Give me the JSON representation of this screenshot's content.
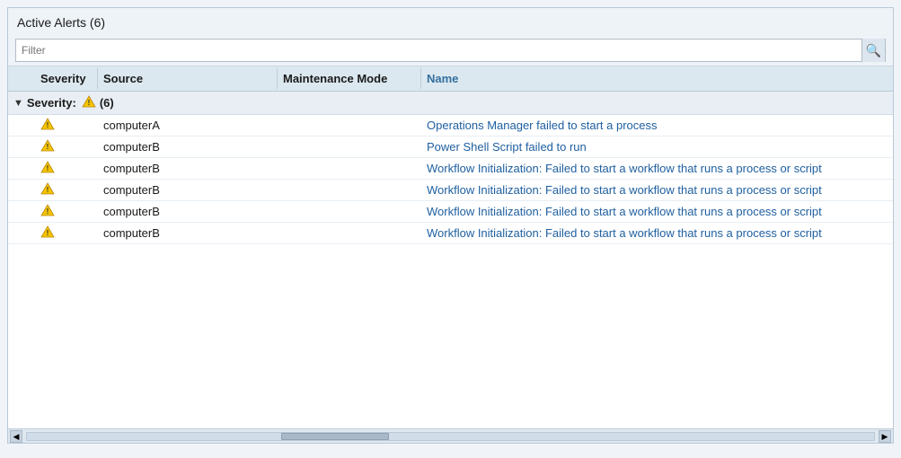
{
  "title": "Active Alerts (6)",
  "search": {
    "placeholder": "Filter",
    "value": ""
  },
  "columns": {
    "severity": "Severity",
    "source": "Source",
    "maintenance": "Maintenance Mode",
    "name": "Name"
  },
  "group": {
    "label": "Severity:",
    "count": "(6)"
  },
  "rows": [
    {
      "severity": "warning",
      "source": "computerA",
      "maintenance": "",
      "name": "Operations Manager failed to start a process"
    },
    {
      "severity": "warning",
      "source": "computerB",
      "maintenance": "",
      "name": "Power Shell Script failed to run"
    },
    {
      "severity": "warning",
      "source": "computerB",
      "maintenance": "",
      "name": "Workflow Initialization: Failed to start a workflow that runs a process or script"
    },
    {
      "severity": "warning",
      "source": "computerB",
      "maintenance": "",
      "name": "Workflow Initialization: Failed to start a workflow that runs a process or script"
    },
    {
      "severity": "warning",
      "source": "computerB",
      "maintenance": "",
      "name": "Workflow Initialization: Failed to start a workflow that runs a process or script"
    },
    {
      "severity": "warning",
      "source": "computerB",
      "maintenance": "",
      "name": "Workflow Initialization: Failed to start a workflow that runs a process or script"
    }
  ],
  "icons": {
    "search": "🔍",
    "warning": "⚠"
  }
}
